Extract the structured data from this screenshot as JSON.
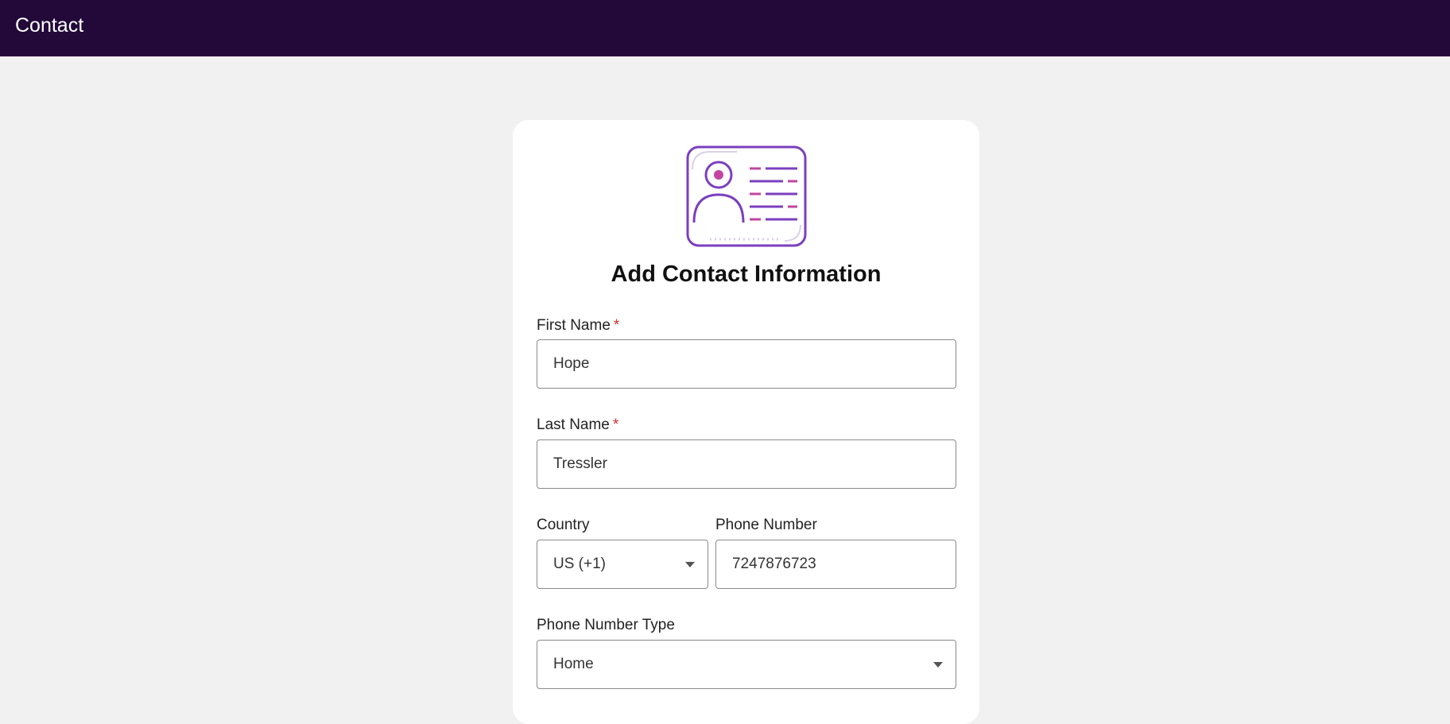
{
  "header": {
    "title": "Contact"
  },
  "form": {
    "heading": "Add Contact Information",
    "first_name": {
      "label": "First Name",
      "required_mark": "*",
      "value": "Hope"
    },
    "last_name": {
      "label": "Last Name",
      "required_mark": "*",
      "value": "Tressler"
    },
    "country": {
      "label": "Country",
      "value": "US (+1)"
    },
    "phone_number": {
      "label": "Phone Number",
      "value": "7247876723"
    },
    "phone_type": {
      "label": "Phone Number Type",
      "value": "Home"
    }
  },
  "colors": {
    "header_bg": "#23093a",
    "page_bg": "#f1f1f1",
    "icon_purple": "#7b3fbf",
    "icon_pink": "#c2469f",
    "required": "#d32f2f"
  },
  "icons": {
    "contact_card": "contact-card-icon",
    "dropdown": "chevron-down-icon"
  }
}
